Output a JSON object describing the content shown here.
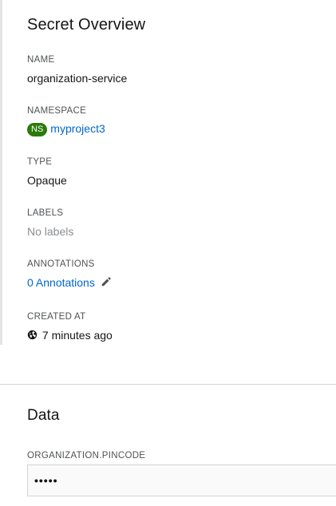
{
  "overview": {
    "title": "Secret Overview",
    "name_label": "NAME",
    "name_value": "organization-service",
    "namespace_label": "NAMESPACE",
    "namespace_badge": "NS",
    "namespace_value": "myproject3",
    "type_label": "TYPE",
    "type_value": "Opaque",
    "labels_label": "LABELS",
    "labels_value": "No labels",
    "annotations_label": "ANNOTATIONS",
    "annotations_value": "0 Annotations",
    "created_label": "CREATED AT",
    "created_value": "7 minutes ago"
  },
  "data_section": {
    "title": "Data",
    "key_label": "ORGANIZATION.PINCODE",
    "key_value_masked": "•••••"
  },
  "colors": {
    "link": "#0066cc",
    "ns_badge": "#2b7a0b",
    "muted": "#8a8d90"
  },
  "icons": {
    "edit": "pencil-icon",
    "created": "globe-icon"
  }
}
